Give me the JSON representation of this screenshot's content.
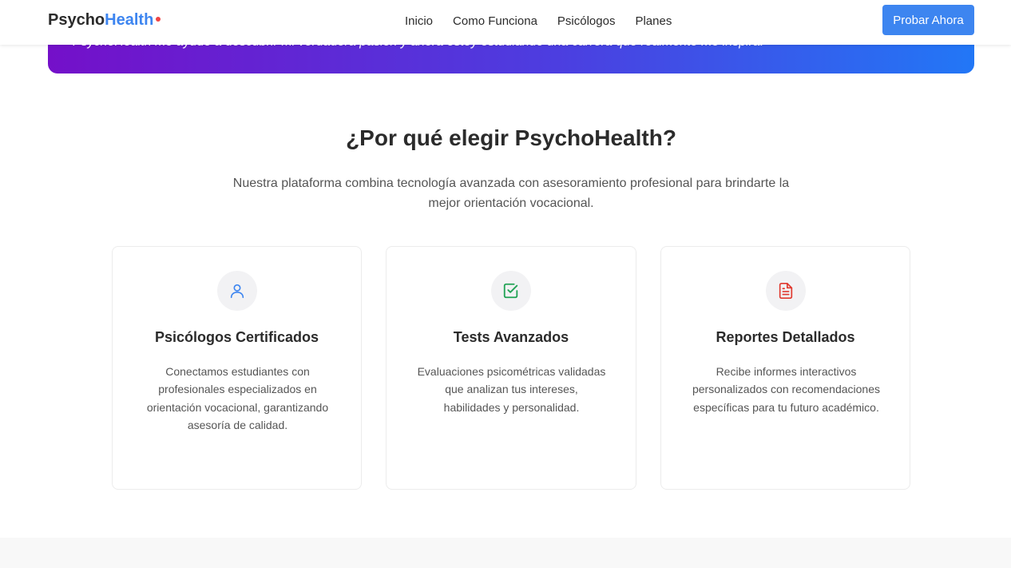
{
  "banner": {
    "quote": "PsychoHealth me ayudó a descubrir mi verdadera pasión y ahora estoy estudiando una carrera que realmente me inspira."
  },
  "navbar": {
    "logo_part1": "Psycho",
    "logo_part2": "Health",
    "links": [
      "Inicio",
      "Como Funciona",
      "Psicólogos",
      "Planes"
    ],
    "cta_label": "Probar Ahora"
  },
  "section": {
    "title": "¿Por qué elegir PsychoHealth?",
    "subtitle": "Nuestra plataforma combina tecnología avanzada con asesoramiento profesional para brindarte la mejor orientación vocacional."
  },
  "cards": [
    {
      "icon": "user-icon",
      "icon_color": "#3d85f0",
      "title": "Psicólogos Certificados",
      "text": "Conectamos estudiantes con profesionales especializados en orientación vocacional, garantizando asesoría de calidad."
    },
    {
      "icon": "check-square-icon",
      "icon_color": "#22a355",
      "title": "Tests Avanzados",
      "text": "Evaluaciones psicométricas validadas que analizan tus intereses, habilidades y personalidad."
    },
    {
      "icon": "document-icon",
      "icon_color": "#e0392f",
      "title": "Reportes Detallados",
      "text": "Recibe informes interactivos personalizados con recomendaciones específicas para tu futuro académico."
    }
  ],
  "colors": {
    "brand_blue": "#3d85f0",
    "logo_dot": "#ef4444",
    "banner_gradient_start": "#7410c9",
    "banner_gradient_end": "#2277f6"
  }
}
